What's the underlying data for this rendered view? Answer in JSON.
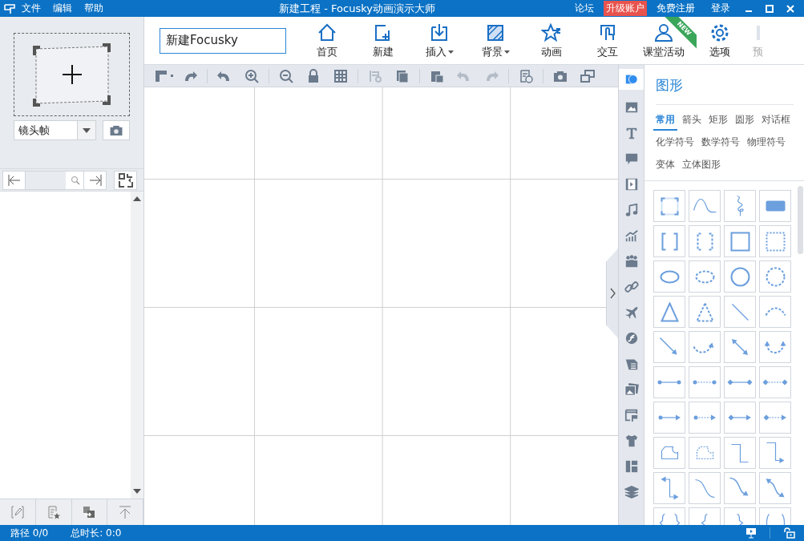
{
  "window": {
    "title": "新建工程 - Focusky动画演示大师"
  },
  "menu": [
    "文件",
    "编辑",
    "帮助"
  ],
  "top_links": [
    {
      "label": "论坛",
      "kind": "plain"
    },
    {
      "label": "升级账户",
      "kind": "highlight"
    },
    {
      "label": "免费注册",
      "kind": "plain"
    },
    {
      "label": "登录",
      "kind": "plain"
    }
  ],
  "ribbon": {
    "title_field": {
      "value": "新建Focusky"
    },
    "buttons": [
      {
        "label": "首页",
        "dropdown": false
      },
      {
        "label": "新建",
        "dropdown": false
      },
      {
        "label": "插入",
        "dropdown": true
      },
      {
        "label": "背景",
        "dropdown": true
      },
      {
        "label": "动画",
        "dropdown": false
      },
      {
        "label": "交互",
        "dropdown": false
      },
      {
        "label": "课堂活动",
        "dropdown": false,
        "badge": "NEW"
      },
      {
        "label": "选项",
        "dropdown": false
      },
      {
        "label": "预",
        "dropdown": false
      }
    ]
  },
  "left_panel": {
    "frame_select": {
      "value": "镜头帧"
    }
  },
  "side_tabs": [
    {
      "selected": true
    },
    {
      "selected": false
    },
    {
      "selected": false
    },
    {
      "selected": false
    },
    {
      "selected": false
    },
    {
      "selected": false
    },
    {
      "selected": false
    },
    {
      "selected": false
    },
    {
      "selected": false
    },
    {
      "selected": false
    },
    {
      "selected": false
    },
    {
      "selected": false
    },
    {
      "selected": false
    },
    {
      "selected": false
    },
    {
      "selected": false
    },
    {
      "selected": false
    },
    {
      "selected": false
    }
  ],
  "shape_panel": {
    "title": "图形",
    "categories": [
      {
        "label": "常用",
        "selected": true
      },
      {
        "label": "箭头",
        "selected": false
      },
      {
        "label": "矩形",
        "selected": false
      },
      {
        "label": "圆形",
        "selected": false
      },
      {
        "label": "对话框",
        "selected": false
      },
      {
        "label": "化学符号",
        "selected": false
      },
      {
        "label": "数学符号",
        "selected": false
      },
      {
        "label": "物理符号",
        "selected": false
      },
      {
        "label": "变体",
        "selected": false
      },
      {
        "label": "立体图形",
        "selected": false
      }
    ]
  },
  "status_bar": {
    "path": "路径 0/0",
    "duration": "总时长: 0:0"
  }
}
